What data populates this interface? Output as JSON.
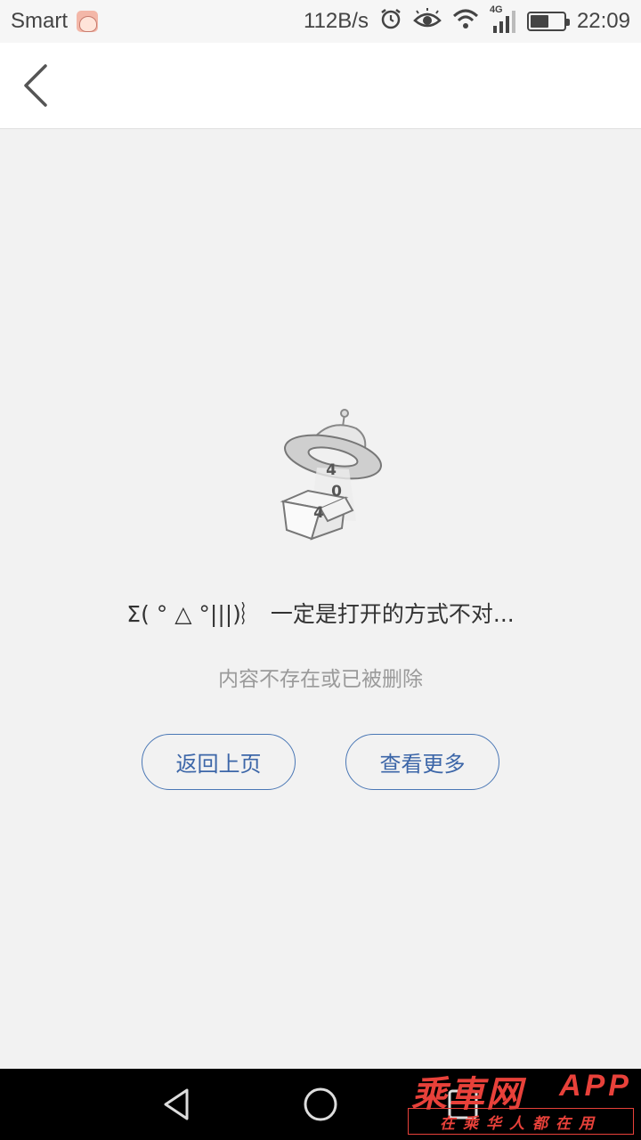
{
  "status_bar": {
    "carrier": "Smart",
    "net_speed": "112B/s",
    "network_type": "4G",
    "battery_level": 0.55,
    "time": "22:09",
    "icons": [
      "alarm-icon",
      "eye-comfort-icon",
      "wifi-icon",
      "signal-icon",
      "battery-icon"
    ]
  },
  "header": {
    "back_icon": "chevron-left-icon"
  },
  "error": {
    "illustration_text": [
      "4",
      "0",
      "4"
    ],
    "message": "Σ( ° △ °|||)︴ 一定是打开的方式不对...",
    "sub_message": "内容不存在或已被删除"
  },
  "actions": {
    "back_label": "返回上页",
    "more_label": "查看更多"
  },
  "nav_bar": {
    "buttons": [
      "back-triangle-icon",
      "home-circle-icon",
      "recents-square-icon"
    ]
  },
  "watermark": {
    "title": "乘車网",
    "app": "APP",
    "slogan": "在乘华人都在用"
  },
  "colors": {
    "accent": "#4a77b5",
    "watermark": "#e8413a",
    "background": "#f2f2f2"
  }
}
